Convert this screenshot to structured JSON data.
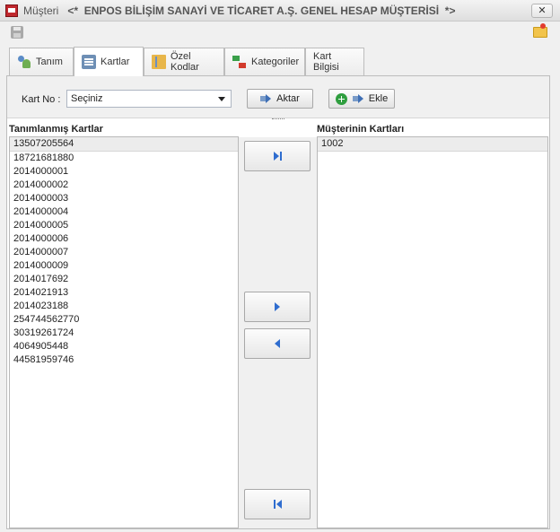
{
  "window": {
    "title": "Müşteri",
    "subtitle": "<*  ENPOS BİLİŞİM SANAYİ VE TİCARET A.Ş. GENEL HESAP MÜŞTERİSİ  *>",
    "close_label": "✕"
  },
  "tabs": [
    {
      "label": "Tanım",
      "icon": "people-icon"
    },
    {
      "label": "Kartlar",
      "icon": "card-icon"
    },
    {
      "label": "Özel Kodlar",
      "icon": "book-icon"
    },
    {
      "label": "Kategoriler",
      "icon": "category-icon"
    },
    {
      "label": "Kart Bilgisi",
      "icon": ""
    }
  ],
  "active_tab": "Kartlar",
  "filter": {
    "label": "Kart No :",
    "selected": "Seçiniz",
    "aktar_label": "Aktar",
    "ekle_label": "Ekle"
  },
  "left_list": {
    "title": "Tanımlanmış Kartlar",
    "items": [
      "13507205564",
      "18721681880",
      "2014000001",
      "2014000002",
      "2014000003",
      "2014000004",
      "2014000005",
      "2014000006",
      "2014000007",
      "2014000009",
      "2014017692",
      "2014021913",
      "2014023188",
      "254744562770",
      "30319261724",
      "4064905448",
      "44581959746"
    ]
  },
  "right_list": {
    "title": "Müşterinin Kartları",
    "items": [
      "1002"
    ]
  },
  "colors": {
    "accent": "#2f6dcf",
    "window_bg": "#f0f0f0"
  }
}
